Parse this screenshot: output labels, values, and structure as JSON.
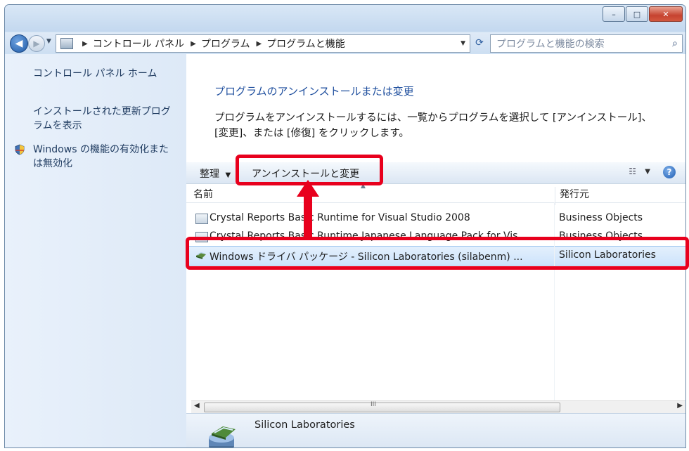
{
  "window": {
    "caption_min": "–",
    "caption_max": "□",
    "caption_close": "✕"
  },
  "nav": {
    "breadcrumb": [
      "コントロール パネル",
      "プログラム",
      "プログラムと機能"
    ],
    "search_placeholder": "プログラムと機能の検索"
  },
  "sidebar": {
    "items": [
      {
        "label": "コントロール パネル ホーム"
      },
      {
        "label": "インストールされた更新プログラムを表示"
      },
      {
        "label": "Windows の機能の有効化または無効化"
      }
    ]
  },
  "content": {
    "heading": "プログラムのアンインストールまたは変更",
    "description": "プログラムをアンインストールするには、一覧からプログラムを選択して [アンインストール]、[変更]、または [修復] をクリックします。"
  },
  "toolbar": {
    "organize_label": "整理",
    "uninstall_label": "アンインストールと変更"
  },
  "list": {
    "columns": [
      "名前",
      "発行元"
    ],
    "rows": [
      {
        "name": "Crystal Reports Basic Runtime for Visual Studio 2008",
        "publisher": "Business Objects"
      },
      {
        "name": "Crystal Reports Basic Runtime Japanese Language Pack for Vis...",
        "publisher": "Business Objects"
      },
      {
        "name": "Windows ドライバ パッケージ - Silicon Laboratories (silabenm) ...",
        "publisher": "Silicon Laboratories"
      }
    ],
    "selected_index": 2,
    "scroll_grip": "III"
  },
  "details": {
    "publisher": "Silicon Laboratories"
  },
  "annotation": {
    "highlight_color": "#e8001d"
  }
}
